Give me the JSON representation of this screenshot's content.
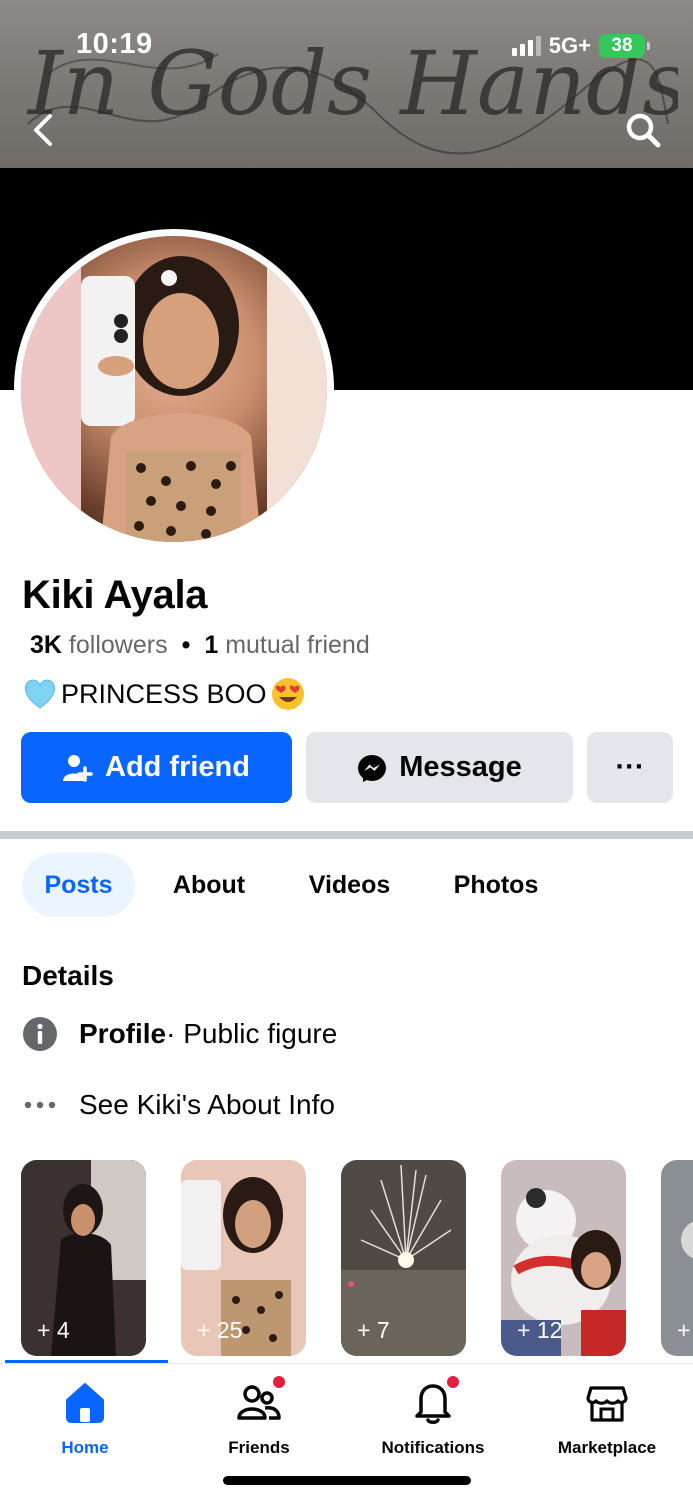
{
  "status_bar": {
    "time": "10:19",
    "network": "5G+",
    "battery": "38"
  },
  "cover": {
    "script_text": "In Gods Hands"
  },
  "profile": {
    "name": "Kiki Ayala",
    "followers_count": "3K",
    "followers_label": "followers",
    "mutual_count": "1",
    "mutual_label": "mutual friend",
    "bio": "PRINCESS BOO"
  },
  "actions": {
    "add_friend": "Add friend",
    "message": "Message",
    "more": "···"
  },
  "tabs": [
    {
      "label": "Posts",
      "active": true
    },
    {
      "label": "About"
    },
    {
      "label": "Videos"
    },
    {
      "label": "Photos"
    }
  ],
  "details": {
    "title": "Details",
    "profile_label": "Profile",
    "profile_value": " · Public figure",
    "about_link": "See Kiki's About Info"
  },
  "highlights": [
    {
      "count": "+ 4",
      "color": "#3a2f2e"
    },
    {
      "count": "+ 25",
      "color": "#b58a73"
    },
    {
      "count": "+ 7",
      "color": "#5b544a"
    },
    {
      "count": "+ 12",
      "color": "#c9c1c3"
    },
    {
      "count": "+",
      "color": "#7b7f86"
    }
  ],
  "bottom_nav": [
    {
      "label": "Home",
      "icon": "home-icon",
      "active": true
    },
    {
      "label": "Friends",
      "icon": "friends-icon",
      "badge": true
    },
    {
      "label": "Notifications",
      "icon": "bell-icon",
      "badge": true
    },
    {
      "label": "Marketplace",
      "icon": "marketplace-icon"
    }
  ],
  "colors": {
    "accent": "#0866ff",
    "button_gray": "#e4e6eb",
    "badge": "#e41e3f",
    "tab_active_bg": "#ebf5ff"
  }
}
